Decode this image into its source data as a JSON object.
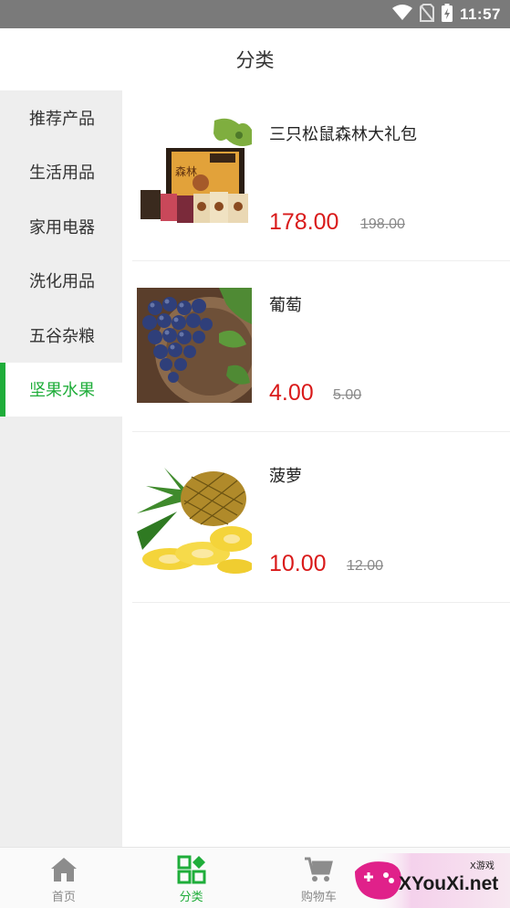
{
  "status_bar": {
    "time": "11:57",
    "icons": [
      "wifi-icon",
      "no-sim-icon",
      "battery-charging-icon"
    ]
  },
  "header": {
    "title": "分类"
  },
  "sidebar": {
    "items": [
      {
        "label": "推荐产品",
        "active": false
      },
      {
        "label": "生活用品",
        "active": false
      },
      {
        "label": "家用电器",
        "active": false
      },
      {
        "label": "洗化用品",
        "active": false
      },
      {
        "label": "五谷杂粮",
        "active": false
      },
      {
        "label": "坚果水果",
        "active": true
      }
    ]
  },
  "products": [
    {
      "name": "三只松鼠森林大礼包",
      "price": "178.00",
      "original_price": "198.00",
      "image": "nut-gift-box-image"
    },
    {
      "name": "葡萄",
      "price": "4.00",
      "original_price": "5.00",
      "image": "grapes-image"
    },
    {
      "name": "菠萝",
      "price": "10.00",
      "original_price": "12.00",
      "image": "pineapple-image"
    }
  ],
  "bottom_nav": {
    "items": [
      {
        "label": "首页",
        "icon": "home-icon",
        "active": false
      },
      {
        "label": "分类",
        "icon": "category-grid-icon",
        "active": true
      },
      {
        "label": "购物车",
        "icon": "cart-icon",
        "active": false
      },
      {
        "label": "",
        "icon": "",
        "active": false
      }
    ]
  },
  "watermark": {
    "text": "XYouXi.net",
    "small_text": "X游戏"
  },
  "colors": {
    "accent": "#1fad3a",
    "price": "#d91a1a",
    "sidebar_bg": "#eeeeee",
    "status_bar": "#7a7a7a"
  }
}
